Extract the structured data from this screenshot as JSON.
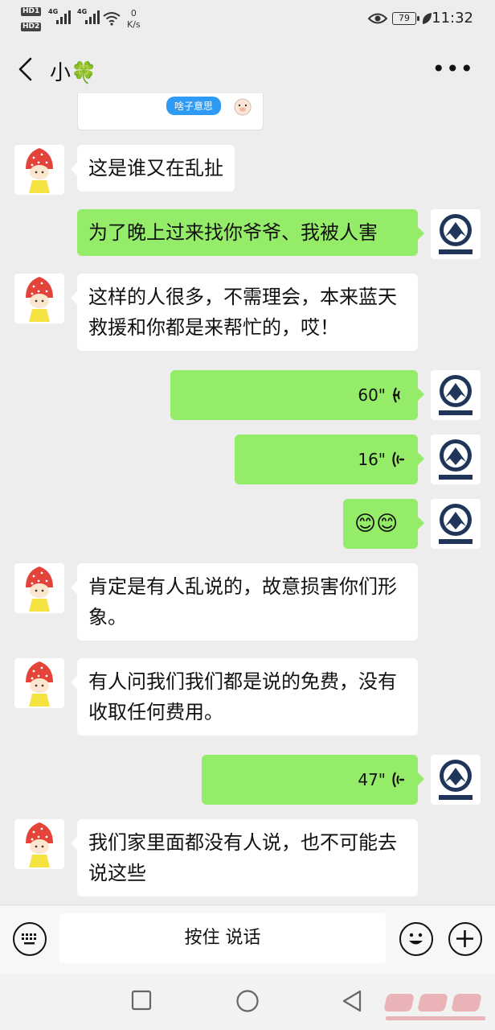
{
  "status_bar": {
    "hd1": "HD1",
    "hd2": "HD2",
    "net1": "4G",
    "net2": "4G",
    "speed_value": "0",
    "speed_unit": "K/s",
    "battery": "79",
    "time": "11:32"
  },
  "nav": {
    "title": "小🍀"
  },
  "quoted_card": {
    "tag": "啥子意思"
  },
  "messages": [
    {
      "side": "in",
      "text": "这是谁又在乱扯"
    },
    {
      "side": "out",
      "text": "为了晚上过来找你爷爷、我被人害"
    },
    {
      "side": "in",
      "text": "这样的人很多，不需理会，本来蓝天救援和你都是来帮忙的，哎！"
    },
    {
      "side": "out",
      "type": "voice",
      "text": "60\""
    },
    {
      "side": "out",
      "type": "voice",
      "text": "16\""
    },
    {
      "side": "out",
      "type": "emoji",
      "text": "😊😊"
    },
    {
      "side": "in",
      "text": "肯定是有人乱说的，故意损害你们形象。"
    },
    {
      "side": "in",
      "text": "有人问我们我们都是说的免费，没有收取任何费用。"
    },
    {
      "side": "out",
      "type": "voice",
      "text": "47\""
    },
    {
      "side": "in",
      "text": "我们家里面都没有人说，也不可能去说这些"
    }
  ],
  "input_bar": {
    "hold_to_talk": "按住 说话"
  },
  "icons": {
    "back": "back-arrow-icon",
    "more": "more-icon",
    "keyboard": "keyboard-icon",
    "emoji": "emoji-icon",
    "plus": "plus-icon",
    "voice": "voice-wave-icon"
  },
  "colors": {
    "outgoing_bubble": "#95ec69",
    "incoming_bubble": "#ffffff",
    "background": "#ededed"
  }
}
